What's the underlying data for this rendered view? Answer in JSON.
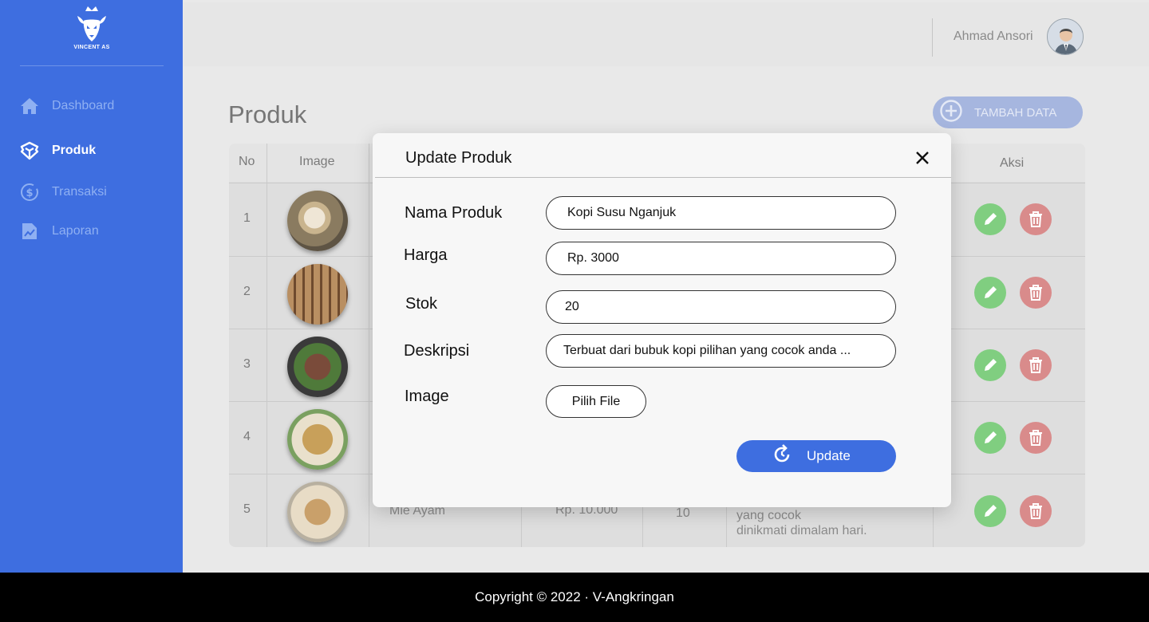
{
  "brand": {
    "logo_text": "VINCENT AS"
  },
  "colors": {
    "primary": "#3e6ee0",
    "edit": "#80ce80",
    "delete": "#d98b8b",
    "footer": "#000000"
  },
  "sidebar": {
    "items": [
      {
        "label": "Dashboard",
        "icon": "home-icon",
        "active": false
      },
      {
        "label": "Produk",
        "icon": "box-icon",
        "active": true
      },
      {
        "label": "Transaksi",
        "icon": "dollar-circle-icon",
        "active": false
      },
      {
        "label": "Laporan",
        "icon": "report-icon",
        "active": false
      }
    ]
  },
  "header": {
    "user_name": "Ahmad Ansori",
    "avatar_icon": "user-avatar-icon"
  },
  "main": {
    "title": "Produk",
    "add_button": "TAMBAH DATA",
    "table": {
      "columns": [
        "No",
        "Image",
        "Aksi"
      ],
      "rows": [
        {
          "no": "1"
        },
        {
          "no": "2"
        },
        {
          "no": "3"
        },
        {
          "no": "4"
        },
        {
          "no": "5",
          "name": "Mie Ayam",
          "price": "Rp. 10.000",
          "stock": "10",
          "desc_line1": "yang cocok",
          "desc_line2": "dinikmati dimalam hari."
        }
      ]
    }
  },
  "modal": {
    "title": "Update Produk",
    "fields": [
      {
        "label": "Nama Produk",
        "value": "Kopi Susu Nganjuk"
      },
      {
        "label": "Harga",
        "value": "Rp. 3000"
      },
      {
        "label": "Stok",
        "value": "20"
      },
      {
        "label": "Deskripsi",
        "value": "Terbuat dari bubuk kopi pilihan yang cocok anda ..."
      }
    ],
    "image_label": "Image",
    "file_button": "Pilih File",
    "update_button": "Update"
  },
  "footer": {
    "text": "Copyright © 2022 · V-Angkringan"
  }
}
